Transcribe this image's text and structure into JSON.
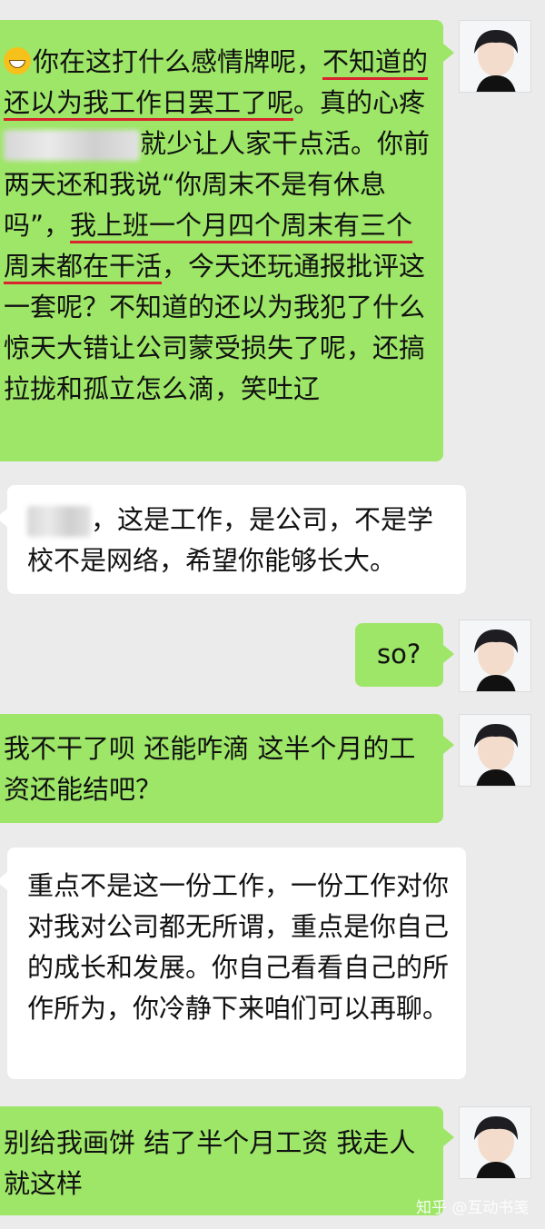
{
  "messages": [
    {
      "side": "right",
      "parts": [
        {
          "t": "你在这打什么感情牌呢，"
        },
        {
          "t": "不知道的还以为我工作日罢工了呢",
          "ul": true
        },
        {
          "t": "。真的心疼"
        },
        {
          "t": "就少让人家干点活。你前两天还和我说“你周末不是有休息吗”，"
        },
        {
          "t": "我上班一个月四个周末有三个周末都在干活",
          "ul": true
        },
        {
          "t": "，今天还玩通报批评这一套呢？不知道的还以为我犯了什么惊天大错让公司蒙受损失了呢，还搞拉拢和孤立怎么滴，笑吐辽"
        }
      ]
    },
    {
      "side": "left",
      "text": "，这是工作，是公司，不是学校不是网络，希望你能够长大。"
    },
    {
      "side": "right",
      "text": "so?"
    },
    {
      "side": "right",
      "text": "我不干了呗 还能咋滴 这半个月的工资还能结吧？"
    },
    {
      "side": "left",
      "text": "重点不是这一份工作，一份工作对你对我对公司都无所谓，重点是你自己的成长和发展。你自己看看自己的所作所为，你冷静下来咱们可以再聊。"
    },
    {
      "side": "right",
      "text": "别给我画饼 结了半个月工资 我走人 就这样"
    }
  ],
  "watermark": "知乎 @互动书笺",
  "colors": {
    "green_bubble": "#9de667",
    "white_bubble": "#ffffff",
    "background": "#ebebeb",
    "underline": "#d9232d"
  }
}
